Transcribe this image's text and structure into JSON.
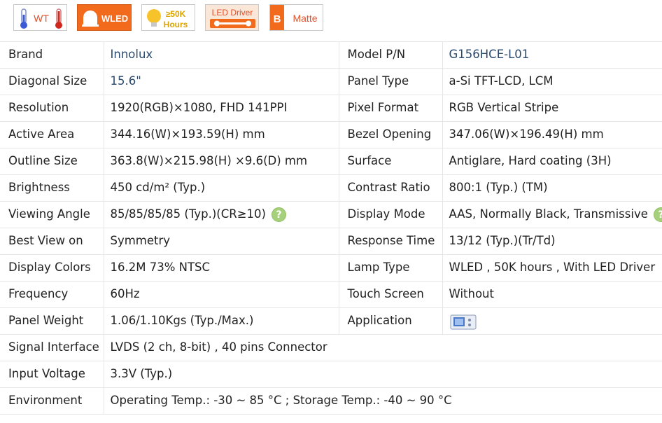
{
  "badges": {
    "wt": "WT",
    "wled": "WLED",
    "hours_top": "≥50K",
    "hours_bottom": "Hours",
    "driver": "LED Driver",
    "b_letter": "B",
    "matte": "Matte"
  },
  "colors": {
    "link": "#2a4a6e",
    "wled_badge": "#f26b1d",
    "help_icon": "#a7d07c"
  },
  "specs": {
    "brand_label": "Brand",
    "brand_value": "Innolux",
    "model_label": "Model P/N",
    "model_value": "G156HCE-L01",
    "diagonal_label": "Diagonal Size",
    "diagonal_value": "15.6\"",
    "panel_type_label": "Panel Type",
    "panel_type_value": "a-Si TFT-LCD, LCM",
    "resolution_label": "Resolution",
    "resolution_value": "1920(RGB)×1080, FHD  141PPI",
    "pixel_format_label": "Pixel Format",
    "pixel_format_value": "RGB Vertical Stripe",
    "active_area_label": "Active Area",
    "active_area_value": "344.16(W)×193.59(H) mm",
    "bezel_label": "Bezel Opening",
    "bezel_value": "347.06(W)×196.49(H) mm",
    "outline_label": "Outline Size",
    "outline_value": "363.8(W)×215.98(H) ×9.6(D) mm",
    "surface_label": "Surface",
    "surface_value": "Antiglare, Hard coating (3H)",
    "brightness_label": "Brightness",
    "brightness_value": "450 cd/m² (Typ.)",
    "contrast_label": "Contrast Ratio",
    "contrast_value": "800:1 (Typ.) (TM)",
    "viewing_label": "Viewing Angle",
    "viewing_value": "85/85/85/85 (Typ.)(CR≥10)",
    "display_mode_label": "Display Mode",
    "display_mode_value": "AAS, Normally Black, Transmissive",
    "best_view_label": "Best View on",
    "best_view_value": "Symmetry",
    "response_label": "Response Time",
    "response_value": "13/12 (Typ.)(Tr/Td)",
    "colors_label": "Display Colors",
    "colors_value": "16.2M   73% NTSC",
    "lamp_label": "Lamp Type",
    "lamp_value": "WLED , 50K hours , With LED Driver",
    "frequency_label": "Frequency",
    "frequency_value": "60Hz",
    "touch_label": "Touch Screen",
    "touch_value": "Without",
    "weight_label": "Panel Weight",
    "weight_value": "1.06/1.10Kgs (Typ./Max.)",
    "application_label": "Application",
    "signal_label": "Signal Interface",
    "signal_value": "LVDS (2 ch, 8-bit) , 40 pins Connector",
    "voltage_label": "Input Voltage",
    "voltage_value": "3.3V (Typ.)",
    "environment_label": "Environment",
    "environment_value": "Operating Temp.: -30 ~ 85 °C ; Storage Temp.: -40 ~ 90 °C",
    "help_glyph": "?"
  }
}
